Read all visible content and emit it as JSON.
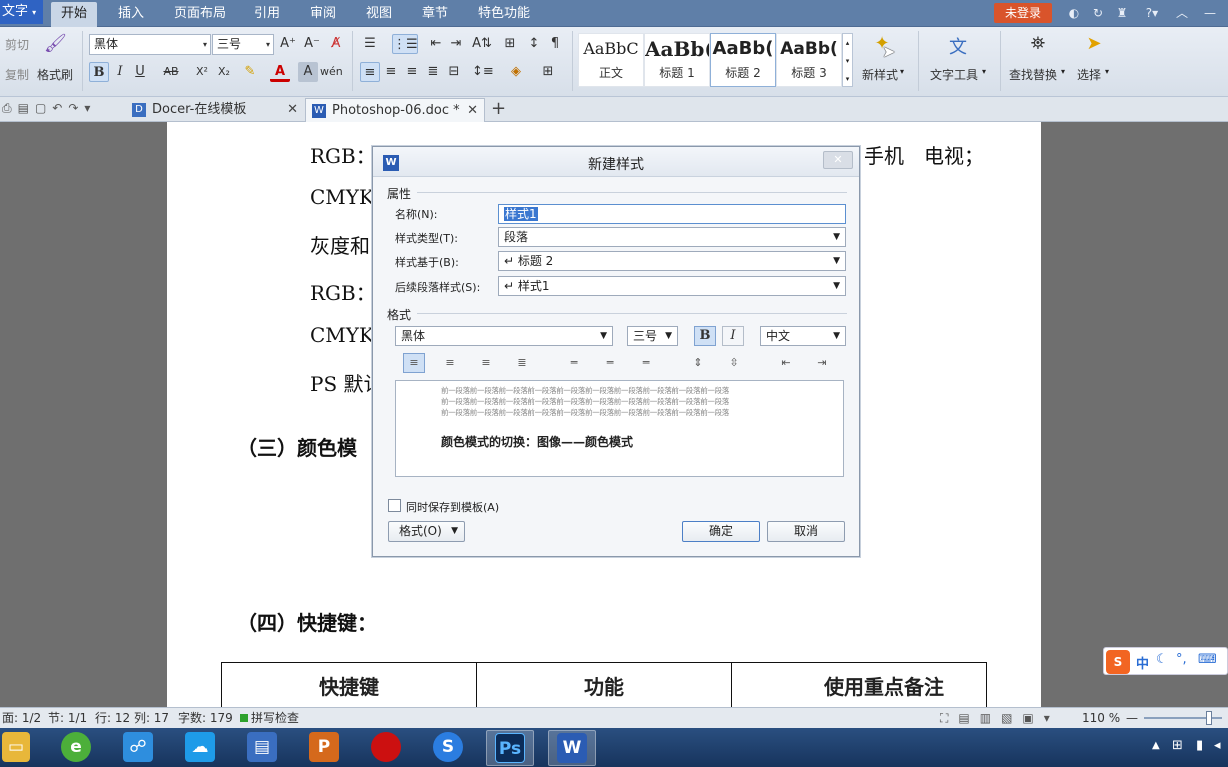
{
  "menubar": {
    "app_label": "文字",
    "items": [
      "开始",
      "插入",
      "页面布局",
      "引用",
      "审阅",
      "视图",
      "章节",
      "特色功能"
    ],
    "login": "未登录"
  },
  "ribbon": {
    "cut": "剪切",
    "copy": "复制",
    "format_painter": "格式刷",
    "font": "黑体",
    "size": "三号",
    "styles": [
      {
        "preview": "AaBbC",
        "label": "正文"
      },
      {
        "preview": "AaBb(",
        "label": "标题 1"
      },
      {
        "preview": "AaBb(",
        "label": "标题 2"
      },
      {
        "preview": "AaBb(",
        "label": "标题 3"
      }
    ],
    "new_style": "新样式",
    "text_tools": "文字工具",
    "find_replace": "查找替换",
    "select": "选择"
  },
  "tabs": {
    "docer": "Docer-在线模板",
    "doc": "Photoshop-06.doc *"
  },
  "document": {
    "line1_left": "RGB：",
    "line1_right": "手机　电视；",
    "line2": "CMYK",
    "line3": "灰度和",
    "line4": "RGB：",
    "line5": "CMYK",
    "line6": "PS 默认",
    "heading3": "（三）颜色模",
    "heading4": "（四）快捷键：",
    "table_headers": [
      "快捷键",
      "功能",
      "使用重点备注"
    ]
  },
  "dialog": {
    "title": "新建样式",
    "group_props": "属性",
    "name_label": "名称(N):",
    "name_value": "样式1",
    "type_label": "样式类型(T):",
    "type_value": "段落",
    "based_label": "样式基于(B):",
    "based_value": "↵ 标题 2",
    "next_label": "后续段落样式(S):",
    "next_value": "↵ 样式1",
    "group_format": "格式",
    "font_value": "黑体",
    "size_value": "三号",
    "bold": "B",
    "italic": "I",
    "lang_value": "中文",
    "preview_gray": "前一段落前一段落前一段落前一段落前一段落前一段落前一段落前一段落前一段落前一段落",
    "preview_text": "颜色模式的切换：图像——颜色模式",
    "save_template": "同时保存到模板(A)",
    "format_btn": "格式(O)",
    "ok": "确定",
    "cancel": "取消"
  },
  "statusbar": {
    "page": "面: 1/2",
    "section": "节: 1/1",
    "position": "行: 12  列: 17",
    "words": "字数: 179",
    "spell": "拼写检查",
    "zoom": "110 %"
  },
  "colors": {
    "menubar": "#5f7fa8",
    "login": "#d9542b",
    "taskbar": "#1f416e"
  }
}
